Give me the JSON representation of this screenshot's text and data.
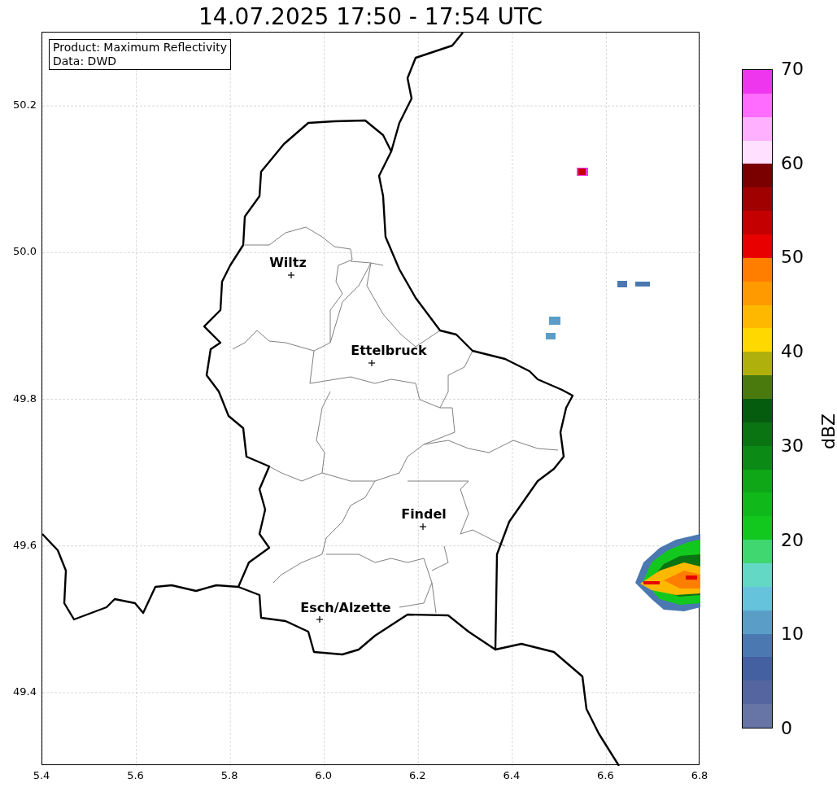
{
  "title": "14.07.2025 17:50 - 17:54 UTC",
  "info_box": [
    "Product: Maximum Reflectivity",
    "Data: DWD"
  ],
  "map": {
    "x_ticks": [
      "5.4",
      "5.6",
      "5.8",
      "6.0",
      "6.2",
      "6.4",
      "6.6",
      "6.8"
    ],
    "y_ticks": [
      "50.2",
      "50.0",
      "49.8",
      "49.6",
      "49.4"
    ],
    "cities": [
      {
        "name": "Wiltz"
      },
      {
        "name": "Ettelbruck"
      },
      {
        "name": "Findel"
      },
      {
        "name": "Esch/Alzette"
      }
    ]
  },
  "colorbar": {
    "label": "dBZ",
    "ticks": [
      "70",
      "60",
      "50",
      "40",
      "30",
      "20",
      "10",
      "0"
    ],
    "bands": [
      {
        "color": "#ee36ee"
      },
      {
        "color": "#ff6cff"
      },
      {
        "color": "#ffb0ff"
      },
      {
        "color": "#ffe0ff"
      },
      {
        "color": "#7a0000"
      },
      {
        "color": "#a00000"
      },
      {
        "color": "#c40000"
      },
      {
        "color": "#e80000"
      },
      {
        "color": "#ff7e00"
      },
      {
        "color": "#ff9a00"
      },
      {
        "color": "#ffb800"
      },
      {
        "color": "#ffd800"
      },
      {
        "color": "#b0b00c"
      },
      {
        "color": "#4a7a0e"
      },
      {
        "color": "#065c0e"
      },
      {
        "color": "#0a7412"
      },
      {
        "color": "#0b8a15"
      },
      {
        "color": "#0fa618"
      },
      {
        "color": "#10b81a"
      },
      {
        "color": "#12c81e"
      },
      {
        "color": "#40d670"
      },
      {
        "color": "#63d8c5"
      },
      {
        "color": "#65c3dc"
      },
      {
        "color": "#5a9ec8"
      },
      {
        "color": "#4b78b0"
      },
      {
        "color": "#4460a0"
      },
      {
        "color": "#55659f"
      },
      {
        "color": "#6675a6"
      }
    ]
  }
}
